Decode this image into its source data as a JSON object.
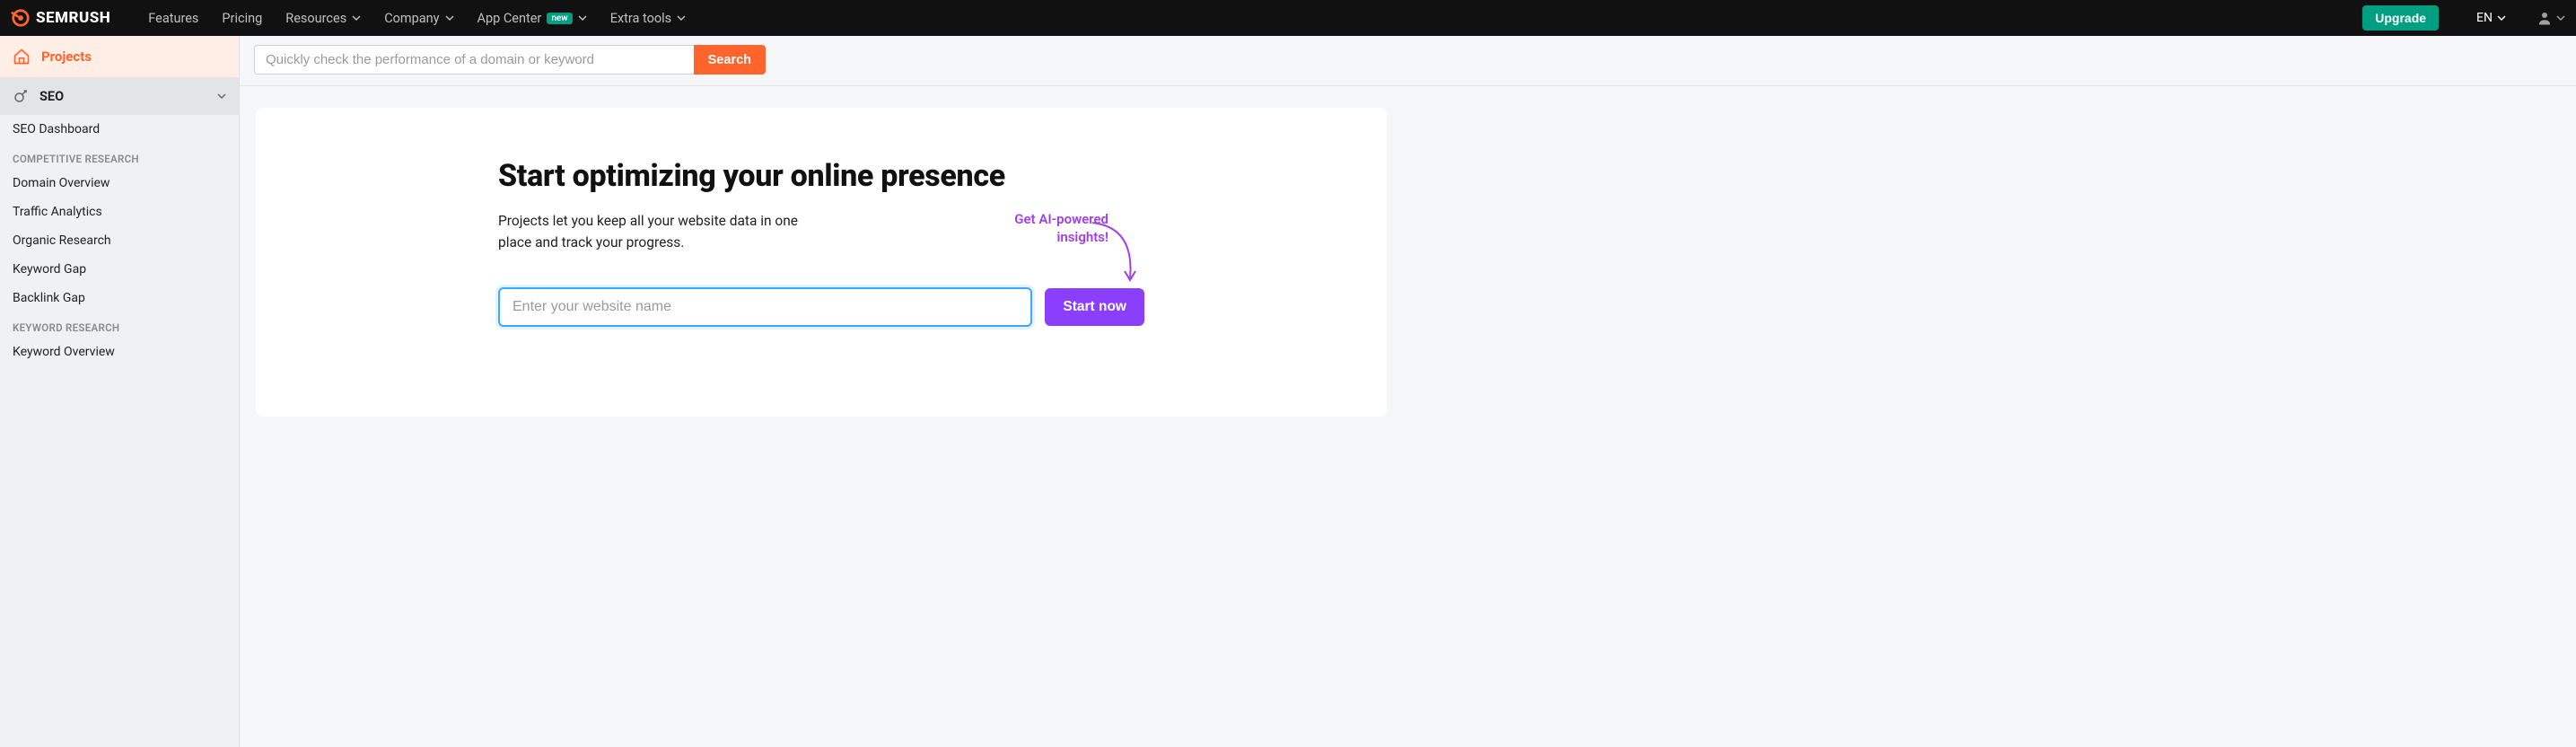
{
  "brand": "SEMRUSH",
  "nav": {
    "features": "Features",
    "pricing": "Pricing",
    "resources": "Resources",
    "company": "Company",
    "appcenter": "App Center",
    "appcenter_badge": "new",
    "extratools": "Extra tools",
    "upgrade": "Upgrade",
    "lang": "EN"
  },
  "sidebar": {
    "projects": "Projects",
    "seo": "SEO",
    "seo_dashboard": "SEO Dashboard",
    "group_competitive": "COMPETITIVE RESEARCH",
    "domain_overview": "Domain Overview",
    "traffic_analytics": "Traffic Analytics",
    "organic_research": "Organic Research",
    "keyword_gap": "Keyword Gap",
    "backlink_gap": "Backlink Gap",
    "group_keyword": "KEYWORD RESEARCH",
    "keyword_overview": "Keyword Overview"
  },
  "search": {
    "placeholder": "Quickly check the performance of a domain or keyword",
    "button": "Search"
  },
  "hero": {
    "title": "Start optimizing your online presence",
    "subtitle": "Projects let you keep all your website data in one place and track your progress.",
    "ai_line1": "Get AI-powered",
    "ai_line2": "insights!",
    "input_placeholder": "Enter your website name",
    "start": "Start now"
  }
}
